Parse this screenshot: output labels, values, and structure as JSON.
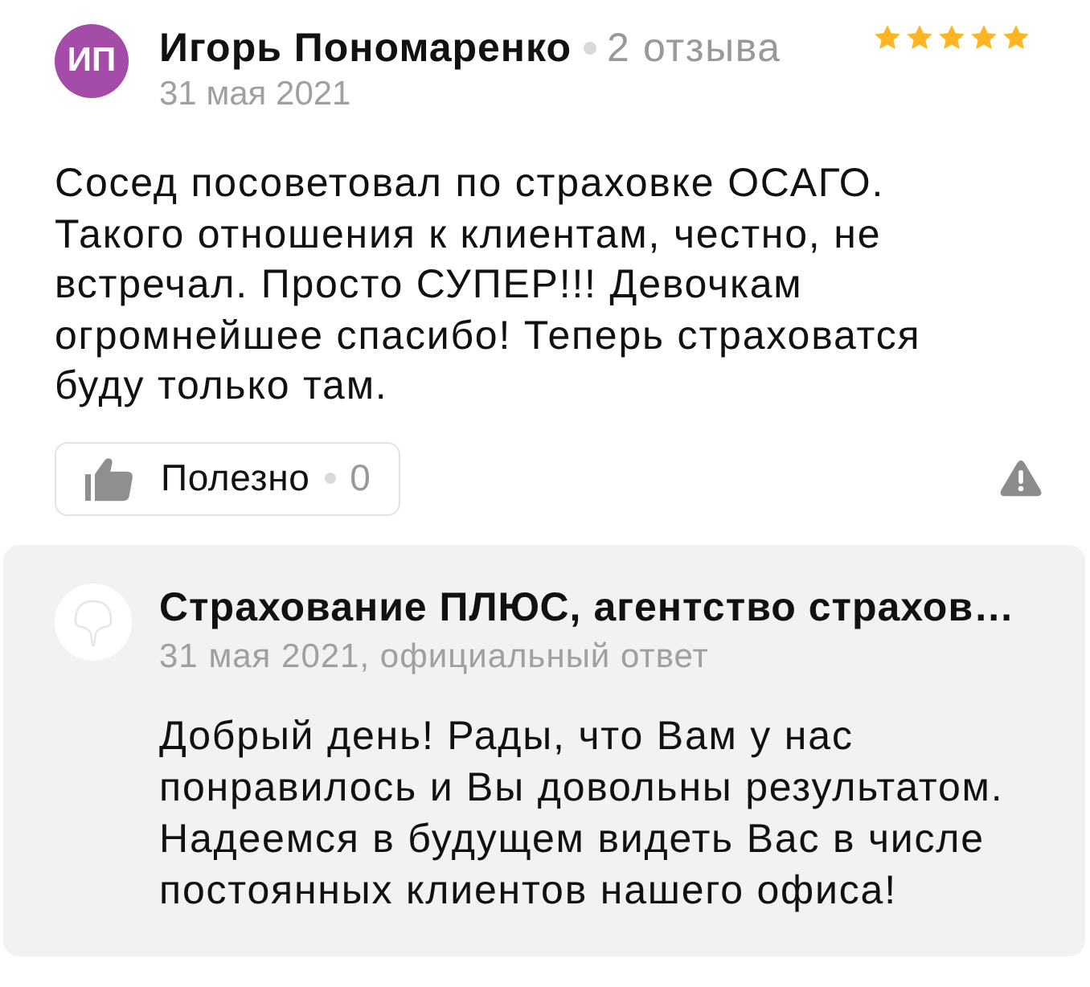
{
  "review": {
    "author": {
      "initials": "ИП",
      "name": "Игорь Пономаренко",
      "reviews_count": "2 отзыва"
    },
    "date": "31 мая 2021",
    "stars": 5,
    "text": "Сосед посоветовал по страховке ОСАГО.\nТакого отношения к клиентам, честно, не\nвстречал. Просто СУПЕР!!! Девочкам\nогромнейшее спасибо! Теперь страховатся\nбуду только там.",
    "helpful": {
      "label": "Полезно",
      "count": "0"
    }
  },
  "reply": {
    "author": "Страхование ПЛЮС, агентство страхов…",
    "meta": "31 мая 2021, официальный ответ",
    "text": "Добрый день! Рады, что Вам у нас\nпонравилось и Вы довольны результатом.\nНадеемся в будущем видеть Вас в числе\nпостоянных клиентов нашего офиса!"
  }
}
